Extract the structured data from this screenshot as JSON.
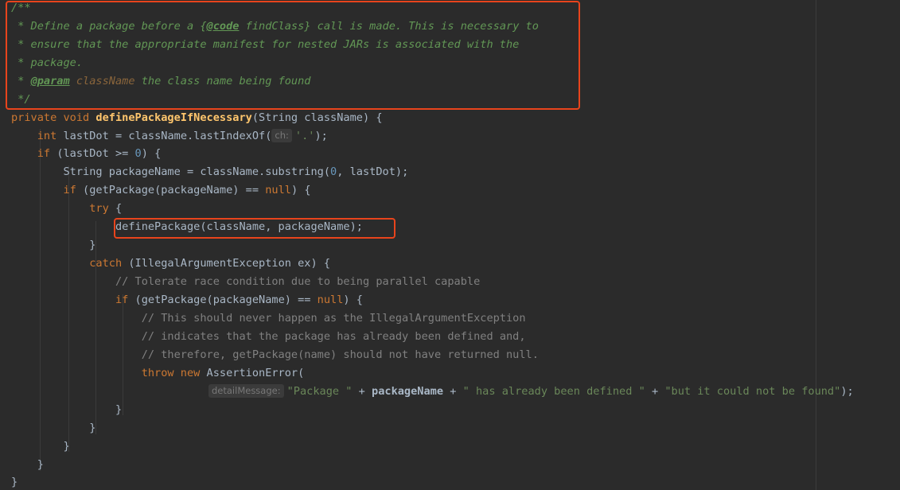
{
  "code": {
    "javadoc": {
      "open": "/**",
      "line1a": " * Define a package before a ",
      "brace_open": "{",
      "code_tag": "@code",
      "line1b": " findClass",
      "brace_close": "}",
      "line1c": " call is made. This is necessary to",
      "line2": " * ensure that the appropriate manifest for nested JARs is associated with the",
      "line3": " * package.",
      "param_prefix": " * ",
      "param_tag": "@param",
      "param_name": " className",
      "param_desc": " the class name being found",
      "close": " */"
    },
    "sig_mod": "private void ",
    "sig_fn": "definePackageIfNecessary",
    "sig_rest": "(String className) {",
    "l_int_kw": "int ",
    "l_int_a": "lastDot = className.lastIndexOf(",
    "hint_ch": "ch:",
    "l_int_str": "'.'",
    "l_int_end": ");",
    "l_if_kw": "if ",
    "l_if_a": "(lastDot >= ",
    "l_if_num": "0",
    "l_if_b": ") {",
    "l_pkg_a": "String packageName = className.substring(",
    "l_pkg_num": "0",
    "l_pkg_b": ", lastDot);",
    "l_if2_kw": "if ",
    "l_if2_a": "(getPackage(packageName) == ",
    "l_if2_null": "null",
    "l_if2_b": ") {",
    "l_try": "try",
    "l_try_b": " {",
    "l_def": "definePackage(className, packageName);",
    "l_close1": "}",
    "l_catch_kw": "catch ",
    "l_catch_b": "(IllegalArgumentException ex) {",
    "c1": "// Tolerate race condition due to being parallel capable",
    "l_if3_kw": "if ",
    "l_if3_a": "(getPackage(packageName) == ",
    "l_if3_null": "null",
    "l_if3_b": ") {",
    "c2": "// This should never happen as the IllegalArgumentException",
    "c3": "// indicates that the package has already been defined and,",
    "c4": "// therefore, getPackage(name) should not have returned null.",
    "l_throw_kw": "throw new ",
    "l_throw_b": "AssertionError(",
    "hint_detail": "detailMessage:",
    "s1": "\"Package \"",
    "op1": " + ",
    "v1": "packageName",
    "op2": " + ",
    "s2": "\" has already been defined \"",
    "op3": " + ",
    "s3": "\"but it could not be found\"",
    "end_throw": ");",
    "b1": "}",
    "b2": "}",
    "b3": "}",
    "b4": "}",
    "b5": "}"
  },
  "colors": {
    "background": "#2b2b2b",
    "keyword": "#cc7832",
    "function": "#ffc66d",
    "string": "#6a8759",
    "comment": "#808080",
    "javadoc": "#629755",
    "highlight_box": "#e8441c"
  }
}
